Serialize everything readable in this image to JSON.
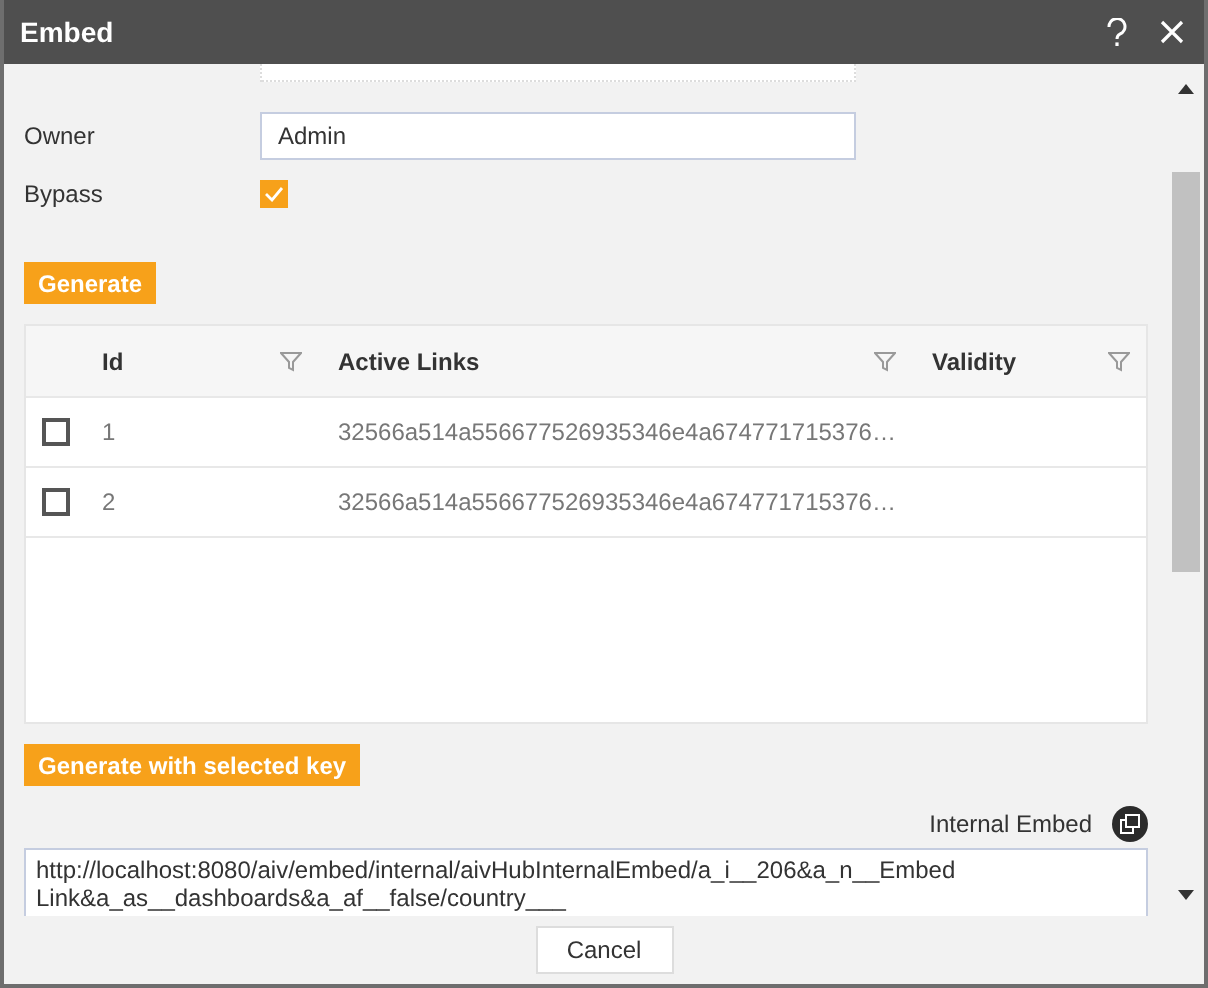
{
  "window": {
    "title": "Embed"
  },
  "fields": [
    {
      "label": "Owner",
      "value": "Admin"
    }
  ],
  "bypass": {
    "label": "Bypass",
    "checked": true
  },
  "generate_button": "Generate",
  "table": {
    "columns": [
      "Id",
      "Active Links",
      "Validity"
    ],
    "rows": [
      {
        "selected": false,
        "id": "1",
        "link": "32566a514a556677526935346e4a674771715376…"
      },
      {
        "selected": false,
        "id": "2",
        "link": "32566a514a556677526935346e4a674771715376…"
      }
    ]
  },
  "generate_selected_button": "Generate with selected key",
  "internal_embed": {
    "label": "Internal Embed",
    "value": "http://localhost:8080/aiv/embed/internal/aivHubInternalEmbed/a_i__206&a_n__Embed Link&a_as__dashboards&a_af__false/country___"
  },
  "footer": {
    "cancel": "Cancel"
  }
}
